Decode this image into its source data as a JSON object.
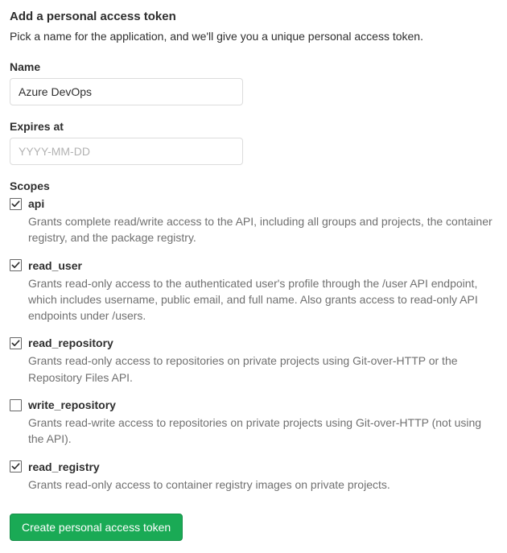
{
  "heading": "Add a personal access token",
  "subtext": "Pick a name for the application, and we'll give you a unique personal access token.",
  "name_label": "Name",
  "name_value": "Azure DevOps",
  "expires_label": "Expires at",
  "expires_placeholder": "YYYY-MM-DD",
  "scopes_label": "Scopes",
  "scopes": [
    {
      "key": "api",
      "label": "api",
      "checked": true,
      "desc": "Grants complete read/write access to the API, including all groups and projects, the container registry, and the package registry."
    },
    {
      "key": "read_user",
      "label": "read_user",
      "checked": true,
      "desc": "Grants read-only access to the authenticated user's profile through the /user API endpoint, which includes username, public email, and full name. Also grants access to read-only API endpoints under /users."
    },
    {
      "key": "read_repository",
      "label": "read_repository",
      "checked": true,
      "desc": "Grants read-only access to repositories on private projects using Git-over-HTTP or the Repository Files API."
    },
    {
      "key": "write_repository",
      "label": "write_repository",
      "checked": false,
      "desc": "Grants read-write access to repositories on private projects using Git-over-HTTP (not using the API)."
    },
    {
      "key": "read_registry",
      "label": "read_registry",
      "checked": true,
      "desc": "Grants read-only access to container registry images on private projects."
    }
  ],
  "create_button": "Create personal access token"
}
